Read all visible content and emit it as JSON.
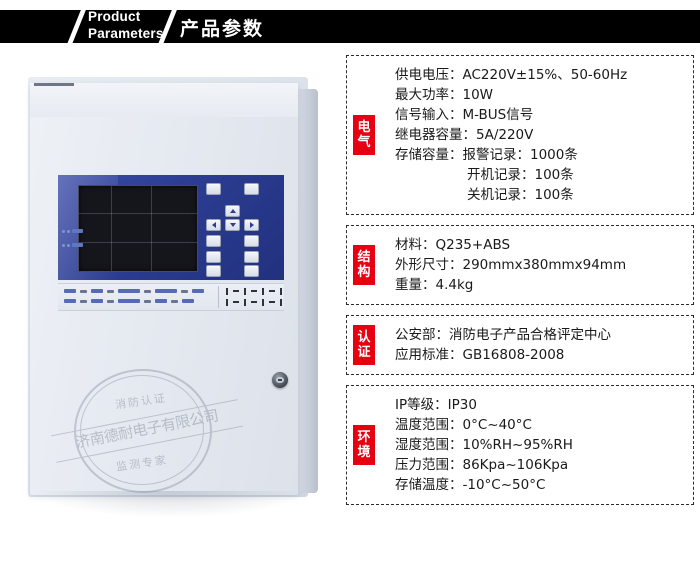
{
  "header": {
    "title_en_line1": "Product",
    "title_en_line2": "Parameters",
    "title_cn": "产品参数"
  },
  "product": {
    "watermark": {
      "top_arc": "消防认证",
      "center": "济南德耐电子有限公司",
      "bottom_arc": "监测专家"
    }
  },
  "spec_boxes": [
    {
      "tab_chars": [
        "电",
        "气"
      ],
      "lines": [
        {
          "text": "供电电压：AC220V±15%、50-60Hz",
          "indent": false
        },
        {
          "text": "最大功率：10W",
          "indent": false
        },
        {
          "text": "信号输入：M-BUS信号",
          "indent": false
        },
        {
          "text": "继电器容量：5A/220V",
          "indent": false
        },
        {
          "text": "存储容量：报警记录：1000条",
          "indent": false
        },
        {
          "text": "开机记录：100条",
          "indent": true
        },
        {
          "text": "关机记录：100条",
          "indent": true
        }
      ]
    },
    {
      "tab_chars": [
        "结",
        "构"
      ],
      "lines": [
        {
          "text": "材料：Q235+ABS",
          "indent": false
        },
        {
          "text": "外形尺寸：290mmx380mmx94mm",
          "indent": false
        },
        {
          "text": "重量：4.4kg",
          "indent": false
        }
      ]
    },
    {
      "tab_chars": [
        "认",
        "证"
      ],
      "lines": [
        {
          "text": "公安部：消防电子产品合格评定中心",
          "indent": false
        },
        {
          "text": "应用标准：GB16808-2008",
          "indent": false
        }
      ]
    },
    {
      "tab_chars": [
        "环",
        "境"
      ],
      "lines": [
        {
          "text": "IP等级：IP30",
          "indent": false
        },
        {
          "text": "温度范围：0°C~40°C",
          "indent": false
        },
        {
          "text": "湿度范围：10%RH~95%RH",
          "indent": false
        },
        {
          "text": "压力范围：86Kpa~106Kpa",
          "indent": false
        },
        {
          "text": "存储温度：-10°C~50°C",
          "indent": false
        }
      ]
    }
  ],
  "colors": {
    "tab_red": "#e60012",
    "banner_black": "#000000",
    "panel_blue": "#2c3d93"
  }
}
